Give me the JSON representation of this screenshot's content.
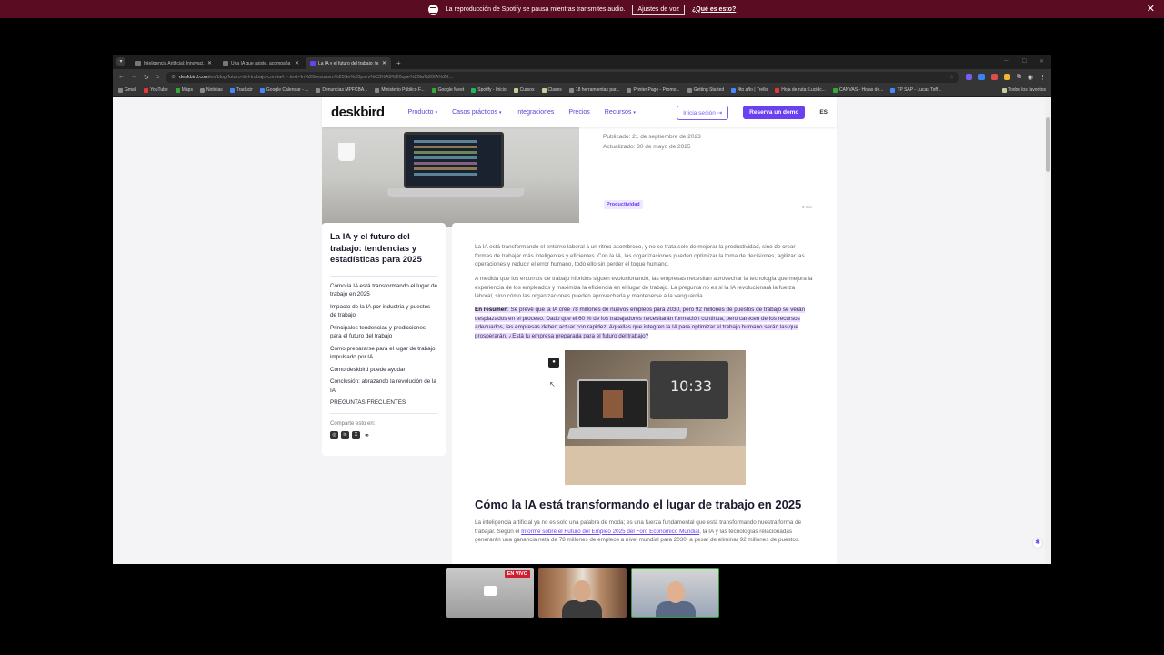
{
  "spotify_bar": {
    "message": "La reproducción de Spotify se pausa mientras transmites audio.",
    "settings_button": "Ajustes de voz",
    "info_link": "¿Qué es esto?",
    "close": "✕"
  },
  "browser": {
    "tabs": [
      {
        "label": "Inteligencia Artificial: Innovaci..."
      },
      {
        "label": "Una IA que asiste, acompaña y..."
      },
      {
        "label": "La IA y el futuro del trabajo: te..."
      }
    ],
    "new_tab": "+",
    "address": {
      "host": "deskbird.com",
      "path": "/es/blog/futuro-del-trabajo-con-ia#:~:text=In%20resumen%20Se%20prev%C3%A9%20que%20la%20IA%20..."
    },
    "bookmarks": [
      "Gmail",
      "YouTube",
      "Maps",
      "Noticias",
      "Traducir",
      "Google Calendar - ...",
      "Denuncias MPFCBA...",
      "Ministerio Público F...",
      "Google Meet",
      "Spotify - Inicio",
      "Cursos",
      "Clases",
      "18 herramientas par...",
      "Printer Page - Promo...",
      "Getting Started",
      "4to año | Trello",
      "Hoja de ruta: Lucidc...",
      "CANVAS - Hojas de...",
      "TP SAP - Lucas Toff..."
    ],
    "all_bookmarks": "Todos los favoritos",
    "ext_colors": [
      "#7a5cf0",
      "#3b82f6",
      "#e04b4b",
      "#f0b43b"
    ]
  },
  "site_nav": {
    "logo": "deskbird",
    "items": [
      "Producto",
      "Casos prácticos",
      "Integraciones",
      "Precios",
      "Recursos"
    ],
    "login": "Inicia sesión",
    "demo": "Reserva un demo",
    "lang": "ES"
  },
  "hero": {
    "published": "Publicado: 21 de septiembre de 2023",
    "updated": "Actualizado: 30 de mayo de 2025",
    "tag": "Productividad",
    "read_time": "3 min"
  },
  "toc": {
    "title": "La IA y el futuro del trabajo: tendencias y estadísticas para 2025",
    "items": [
      "Cómo la IA está transformando el lugar de trabajo en 2025",
      "Impacto de la IA por industria y puestos de trabajo",
      "Principales tendencias y predicciones para el futuro del trabajo",
      "Cómo prepararse para el lugar de trabajo impulsado por IA",
      "Cómo deskbird puede ayudar",
      "Conclusión: abrazando la revolución de la IA",
      "PREGUNTAS FRECUENTES"
    ],
    "share_label": "Comparte esto en:"
  },
  "article": {
    "p1": "La IA está transformando el entorno laboral a un ritmo asombroso, y no se trata solo de mejorar la productividad, sino de crear formas de trabajar más inteligentes y eficientes. Con la IA, las organizaciones pueden optimizar la toma de decisiones, agilizar las operaciones y reducir el error humano, todo ello sin perder el toque humano.",
    "p2": "A medida que los entornos de trabajo híbridos siguen evolucionando, las empresas necesitan aprovechar la tecnología que mejora la experiencia de los empleados y maximiza la eficiencia en el lugar de trabajo. La pregunta no es si la IA revolucionará la fuerza laboral, sino cómo las organizaciones pueden aprovecharla y mantenerse a la vanguardia.",
    "summary_label": "En resumen",
    "summary": ": Se prevé que la IA cree 78 millones de nuevos empleos para 2030, pero 92 millones de puestos de trabajo se verán desplazados en el proceso. Dado que el 60 % de los trabajadores necesitarán formación continua, pero carecen de los recursos adecuados, las empresas deben actuar con rapidez. Aquellas que integren la IA para optimizar el trabajo humano serán las que prosperarán. ¿Está tu empresa preparada para el futuro del trabajo?",
    "image_clock": "10:33",
    "heading": "Cómo la IA está transformando el lugar de trabajo en 2025",
    "p4_start": "La inteligencia artificial ya no es solo una palabra de moda; es una fuerza fundamental que está transformando nuestra forma de trabajar. Según el ",
    "p4_link": "Informe sobre el Futuro del Empleo 2025 del Foro Económico Mundial",
    "p4_end": ", la IA y las tecnologías relacionadas generarán una ganancia neta de 78 millones de empleos a nivel mundial para 2030, a pesar de eliminar 92 millones de puestos."
  },
  "call": {
    "live_badge": "EN VIVO"
  }
}
